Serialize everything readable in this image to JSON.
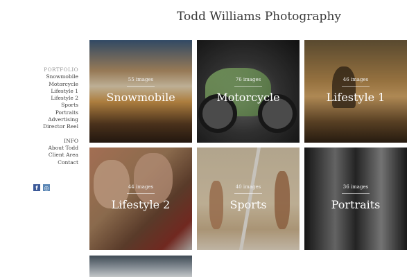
{
  "header": {
    "title": "Todd Williams Photography"
  },
  "sidebar": {
    "portfolio_heading": "PORTFOLIO",
    "portfolio_items": [
      "Snowmobile",
      "Motorcycle",
      "Lifestyle 1",
      "Lifestyle 2",
      "Sports",
      "Portraits",
      "Advertising",
      "Director Reel"
    ],
    "info_heading": "INFO",
    "info_items": [
      "About Todd",
      "Client Area",
      "Contact"
    ]
  },
  "social": {
    "facebook": "f",
    "instagram": "◎"
  },
  "gallery": {
    "tiles": [
      {
        "name": "Snowmobile",
        "count": "55 images"
      },
      {
        "name": "Motorcycle",
        "count": "76 images"
      },
      {
        "name": "Lifestyle 1",
        "count": "46 images"
      },
      {
        "name": "Lifestyle 2",
        "count": "44 images"
      },
      {
        "name": "Sports",
        "count": "40 images"
      },
      {
        "name": "Portraits",
        "count": "36 images"
      }
    ]
  },
  "colors": {
    "facebook": "#3b5998",
    "instagram": "#5a86b5",
    "nav_heading": "#9a9a9a"
  }
}
